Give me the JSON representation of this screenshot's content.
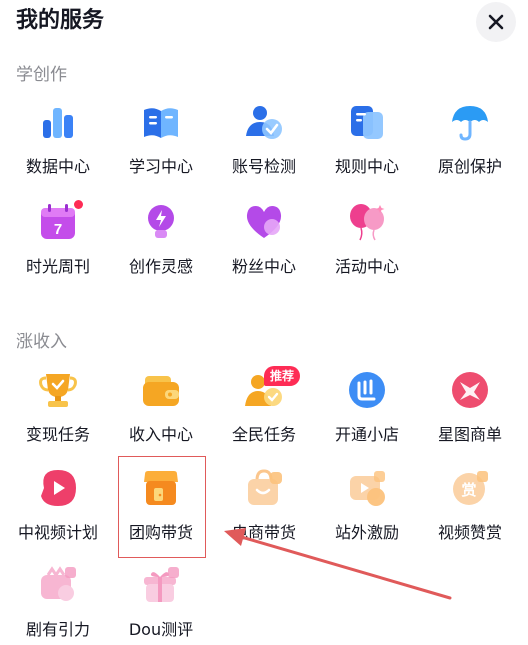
{
  "header": {
    "title": "我的服务",
    "close_icon": "close-icon"
  },
  "sections": [
    {
      "title": "学创作",
      "items": [
        {
          "label": "数据中心",
          "icon": "bar-chart-icon"
        },
        {
          "label": "学习中心",
          "icon": "book-icon"
        },
        {
          "label": "账号检测",
          "icon": "account-check-icon"
        },
        {
          "label": "规则中心",
          "icon": "rules-doc-icon"
        },
        {
          "label": "原创保护",
          "icon": "umbrella-icon"
        },
        {
          "label": "时光周刊",
          "icon": "calendar-icon",
          "calendar_day": "7",
          "dot": true
        },
        {
          "label": "创作灵感",
          "icon": "lightbulb-icon"
        },
        {
          "label": "粉丝中心",
          "icon": "heart-icon"
        },
        {
          "label": "活动中心",
          "icon": "balloons-icon"
        }
      ]
    },
    {
      "title": "涨收入",
      "items": [
        {
          "label": "变现任务",
          "icon": "trophy-icon"
        },
        {
          "label": "收入中心",
          "icon": "wallet-icon"
        },
        {
          "label": "全民任务",
          "icon": "people-task-icon",
          "badge": "推荐"
        },
        {
          "label": "开通小店",
          "icon": "shop-icon"
        },
        {
          "label": "星图商单",
          "icon": "star-map-icon"
        },
        {
          "label": "中视频计划",
          "icon": "play-icon"
        },
        {
          "label": "团购带货",
          "icon": "group-buy-store-icon"
        },
        {
          "label": "电商带货",
          "icon": "shopping-bag-icon"
        },
        {
          "label": "站外激励",
          "icon": "external-reward-icon"
        },
        {
          "label": "视频赞赏",
          "icon": "reward-coin-icon",
          "coin_text": "赏"
        },
        {
          "label": "剧有引力",
          "icon": "drama-gift-icon"
        },
        {
          "label": "Dou测评",
          "icon": "gift-box-icon"
        }
      ]
    }
  ],
  "colors": {
    "accent_red": "#fe2c55",
    "annotation_red": "#e05a5a",
    "section_gray": "#8a8b91"
  }
}
